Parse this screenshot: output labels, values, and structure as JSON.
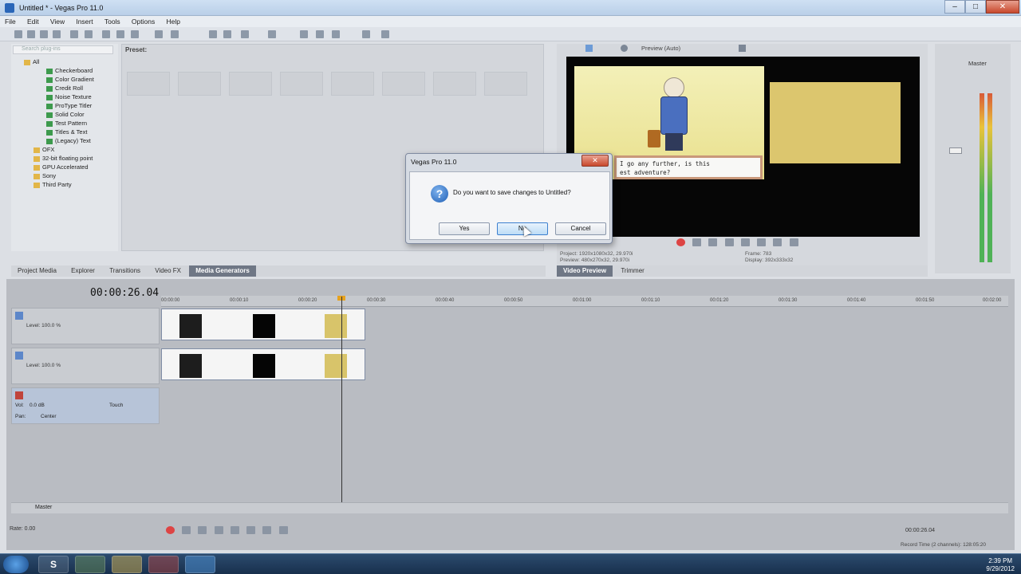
{
  "window": {
    "title": "Untitled * - Vegas Pro 11.0",
    "min": "–",
    "max": "□",
    "close": "✕"
  },
  "menu": [
    "File",
    "Edit",
    "View",
    "Insert",
    "Tools",
    "Options",
    "Help"
  ],
  "generators": {
    "search_placeholder": "Search plug-ins",
    "root": "All",
    "items": [
      "Checkerboard",
      "Color Gradient",
      "Credit Roll",
      "Noise Texture",
      "ProType Titler",
      "Solid Color",
      "Test Pattern",
      "Titles & Text",
      "(Legacy) Text"
    ],
    "folders": [
      "OFX",
      "32-bit floating point",
      "GPU Accelerated",
      "Sony",
      "Third Party"
    ],
    "preset_label": "Preset:"
  },
  "left_tabs": [
    "Project Media",
    "Explorer",
    "Transitions",
    "Video FX",
    "Media Generators"
  ],
  "left_active_tab": "Media Generators",
  "preview": {
    "mode": "Preview (Auto)",
    "caption_line1": "I go any further, is this",
    "caption_line2": "est adventure?",
    "info": {
      "project": "Project:    1920x1080x32, 29.970i",
      "preview": "Preview:    480x270x32, 29.970i",
      "frame": "Frame:      783",
      "display": "Display:    392x333x32"
    },
    "tabs": [
      "Video Preview",
      "Trimmer"
    ],
    "active_tab": "Video Preview"
  },
  "mixer": {
    "label": "Master"
  },
  "timeline": {
    "time": "00:00:26.04",
    "ruler": [
      "00:00:00",
      "00:00:10",
      "00:00:20",
      "00:00:30",
      "00:00:40",
      "00:00:50",
      "00:01:00",
      "00:01:10",
      "00:01:20",
      "00:01:30",
      "00:01:40",
      "00:01:50",
      "00:02:00"
    ],
    "tracks": [
      {
        "type": "video",
        "level": "Level: 100.0 %"
      },
      {
        "type": "video",
        "level": "Level: 100.0 %"
      }
    ],
    "audio": {
      "vol": "Vol:",
      "vol_value": "0.0 dB",
      "touch": "Touch",
      "pan": "Pan:",
      "pan_value": "Center"
    },
    "master_label": "Master",
    "rate": "Rate: 0.00",
    "status_time": "00:00:26.04",
    "record_time": "Record Time (2 channels): 128:05:20"
  },
  "dialog": {
    "title": "Vegas Pro 11.0",
    "close": "✕",
    "icon": "?",
    "message": "Do you want to save changes to Untitled?",
    "buttons": {
      "yes": "Yes",
      "no": "No",
      "cancel": "Cancel"
    }
  },
  "taskbar": {
    "skype_label": "S",
    "time": "2:39 PM",
    "date": "9/29/2012"
  },
  "colors": {
    "accent": "#3c7fcf",
    "video_track": "#5d87c9",
    "audio_track": "#c0443b",
    "close_button": "#c8482c"
  }
}
